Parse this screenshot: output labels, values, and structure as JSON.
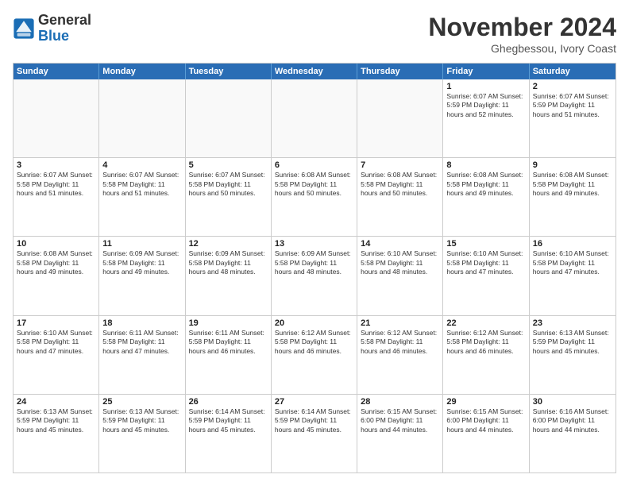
{
  "logo": {
    "general": "General",
    "blue": "Blue"
  },
  "header": {
    "month": "November 2024",
    "location": "Ghegbessou, Ivory Coast"
  },
  "days_of_week": [
    "Sunday",
    "Monday",
    "Tuesday",
    "Wednesday",
    "Thursday",
    "Friday",
    "Saturday"
  ],
  "weeks": [
    [
      {
        "day": "",
        "info": ""
      },
      {
        "day": "",
        "info": ""
      },
      {
        "day": "",
        "info": ""
      },
      {
        "day": "",
        "info": ""
      },
      {
        "day": "",
        "info": ""
      },
      {
        "day": "1",
        "info": "Sunrise: 6:07 AM\nSunset: 5:59 PM\nDaylight: 11 hours\nand 52 minutes."
      },
      {
        "day": "2",
        "info": "Sunrise: 6:07 AM\nSunset: 5:59 PM\nDaylight: 11 hours\nand 51 minutes."
      }
    ],
    [
      {
        "day": "3",
        "info": "Sunrise: 6:07 AM\nSunset: 5:58 PM\nDaylight: 11 hours\nand 51 minutes."
      },
      {
        "day": "4",
        "info": "Sunrise: 6:07 AM\nSunset: 5:58 PM\nDaylight: 11 hours\nand 51 minutes."
      },
      {
        "day": "5",
        "info": "Sunrise: 6:07 AM\nSunset: 5:58 PM\nDaylight: 11 hours\nand 50 minutes."
      },
      {
        "day": "6",
        "info": "Sunrise: 6:08 AM\nSunset: 5:58 PM\nDaylight: 11 hours\nand 50 minutes."
      },
      {
        "day": "7",
        "info": "Sunrise: 6:08 AM\nSunset: 5:58 PM\nDaylight: 11 hours\nand 50 minutes."
      },
      {
        "day": "8",
        "info": "Sunrise: 6:08 AM\nSunset: 5:58 PM\nDaylight: 11 hours\nand 49 minutes."
      },
      {
        "day": "9",
        "info": "Sunrise: 6:08 AM\nSunset: 5:58 PM\nDaylight: 11 hours\nand 49 minutes."
      }
    ],
    [
      {
        "day": "10",
        "info": "Sunrise: 6:08 AM\nSunset: 5:58 PM\nDaylight: 11 hours\nand 49 minutes."
      },
      {
        "day": "11",
        "info": "Sunrise: 6:09 AM\nSunset: 5:58 PM\nDaylight: 11 hours\nand 49 minutes."
      },
      {
        "day": "12",
        "info": "Sunrise: 6:09 AM\nSunset: 5:58 PM\nDaylight: 11 hours\nand 48 minutes."
      },
      {
        "day": "13",
        "info": "Sunrise: 6:09 AM\nSunset: 5:58 PM\nDaylight: 11 hours\nand 48 minutes."
      },
      {
        "day": "14",
        "info": "Sunrise: 6:10 AM\nSunset: 5:58 PM\nDaylight: 11 hours\nand 48 minutes."
      },
      {
        "day": "15",
        "info": "Sunrise: 6:10 AM\nSunset: 5:58 PM\nDaylight: 11 hours\nand 47 minutes."
      },
      {
        "day": "16",
        "info": "Sunrise: 6:10 AM\nSunset: 5:58 PM\nDaylight: 11 hours\nand 47 minutes."
      }
    ],
    [
      {
        "day": "17",
        "info": "Sunrise: 6:10 AM\nSunset: 5:58 PM\nDaylight: 11 hours\nand 47 minutes."
      },
      {
        "day": "18",
        "info": "Sunrise: 6:11 AM\nSunset: 5:58 PM\nDaylight: 11 hours\nand 47 minutes."
      },
      {
        "day": "19",
        "info": "Sunrise: 6:11 AM\nSunset: 5:58 PM\nDaylight: 11 hours\nand 46 minutes."
      },
      {
        "day": "20",
        "info": "Sunrise: 6:12 AM\nSunset: 5:58 PM\nDaylight: 11 hours\nand 46 minutes."
      },
      {
        "day": "21",
        "info": "Sunrise: 6:12 AM\nSunset: 5:58 PM\nDaylight: 11 hours\nand 46 minutes."
      },
      {
        "day": "22",
        "info": "Sunrise: 6:12 AM\nSunset: 5:58 PM\nDaylight: 11 hours\nand 46 minutes."
      },
      {
        "day": "23",
        "info": "Sunrise: 6:13 AM\nSunset: 5:59 PM\nDaylight: 11 hours\nand 45 minutes."
      }
    ],
    [
      {
        "day": "24",
        "info": "Sunrise: 6:13 AM\nSunset: 5:59 PM\nDaylight: 11 hours\nand 45 minutes."
      },
      {
        "day": "25",
        "info": "Sunrise: 6:13 AM\nSunset: 5:59 PM\nDaylight: 11 hours\nand 45 minutes."
      },
      {
        "day": "26",
        "info": "Sunrise: 6:14 AM\nSunset: 5:59 PM\nDaylight: 11 hours\nand 45 minutes."
      },
      {
        "day": "27",
        "info": "Sunrise: 6:14 AM\nSunset: 5:59 PM\nDaylight: 11 hours\nand 45 minutes."
      },
      {
        "day": "28",
        "info": "Sunrise: 6:15 AM\nSunset: 6:00 PM\nDaylight: 11 hours\nand 44 minutes."
      },
      {
        "day": "29",
        "info": "Sunrise: 6:15 AM\nSunset: 6:00 PM\nDaylight: 11 hours\nand 44 minutes."
      },
      {
        "day": "30",
        "info": "Sunrise: 6:16 AM\nSunset: 6:00 PM\nDaylight: 11 hours\nand 44 minutes."
      }
    ]
  ]
}
